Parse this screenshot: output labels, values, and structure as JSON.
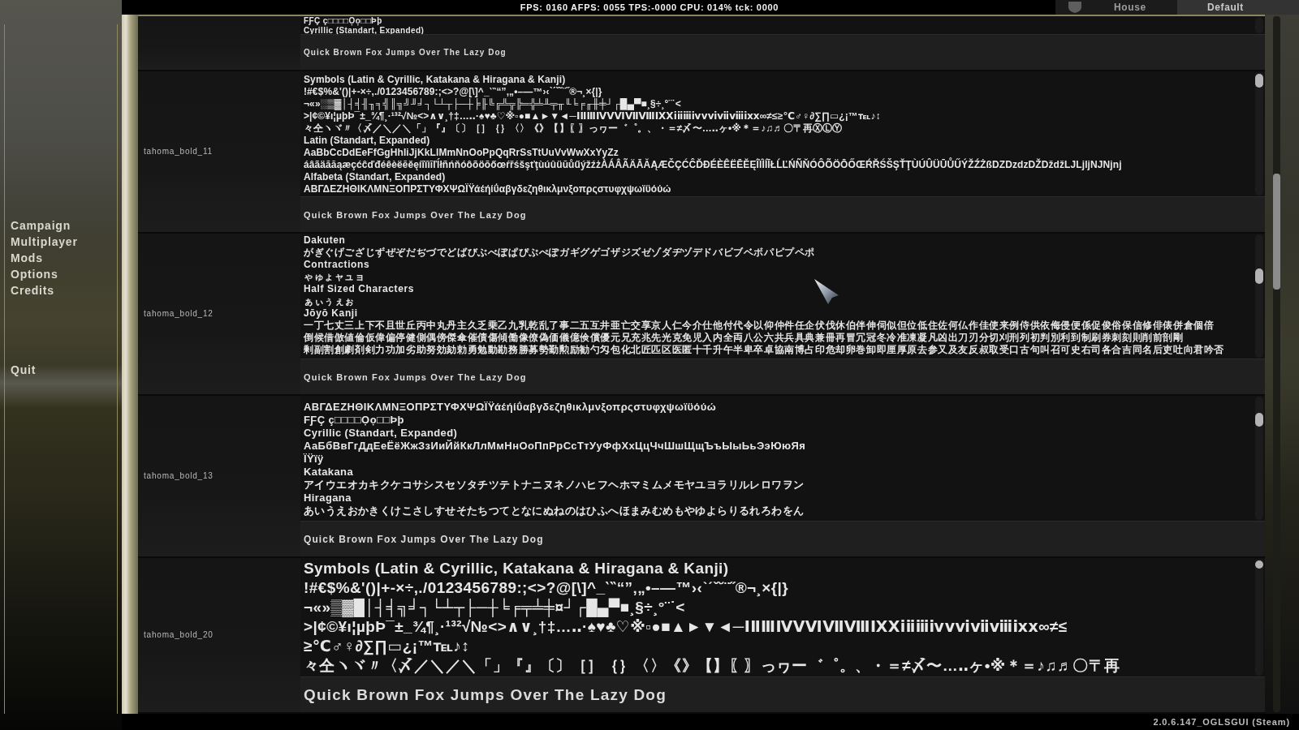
{
  "status_bar": {
    "text": "FPS: 0160 AFPS: 0055 TPS:-0000 CPU: 014% tck: 0000"
  },
  "header_items": [
    {
      "kind": "icon_label",
      "label": "House"
    },
    {
      "kind": "label",
      "label": "Default"
    }
  ],
  "menu": {
    "items": [
      {
        "label": "Campaign"
      },
      {
        "label": "Multiplayer"
      },
      {
        "label": "Mods"
      },
      {
        "label": "Options"
      },
      {
        "label": "Credits"
      }
    ],
    "bottom_items": [
      {
        "label": "Quit"
      }
    ]
  },
  "font_rows": [
    {
      "lines": [
        "FƑÇ ç□□□□Ọọ□□Þþ",
        "Cyrillic (Standart, Expanded)"
      ],
      "preview": "Quick Brown Fox Jumps Over The Lazy Dog"
    },
    {
      "label": "tahoma_bold_11",
      "lines": [
        "Symbols (Latin & Cyrillic, Katakana & Hiragana & Kanji)",
        "!#€$%&'()|+-×÷,./0123456789:;<>?@[\\]^_‵‶“”‚„•–—™›‹ˋˊˇ˘¨˝®¬¸×{|}",
        "¬«»░▒▓│┤╡╢╖╕╣║╗╝╜╛┐└┴┬├─┼╞╟╚╔╩╦╠═╬╧╨╤╥╙╘╒╓╫╪┘┌█▄▀■¸§÷¸°¨˙<",
        ">|¢©¥ı¦µþÞ¯±_¾¶¸·¹³²√№<>∧∨¸†‡…‥·♠♥♣♡※▫●■▲►▼◄─ⅠⅡⅢⅣⅤⅥⅦⅧⅨⅩⅰⅱⅲⅳⅴⅵⅶⅷⅸⅹ∞≠≤≥℃♂♀∂∑∏▭¿¡™℡♪↕",
        "々仝ヽヾ〃〈〆／＼／＼「」『』〔〕［］｛｝〈〉《》【】〖〗っヮー゛゜。、・＝≠〆〜…‥ヶ•※＊＝♪♫♬〇〒再ⓍⓁⓎ",
        "Latin (Standart, Expanded)",
        "AaBbCcDdEeFfGgHhIiJjKkLlMmNnOoPpQqRrSsTtUuVvWwXxYyZz",
        "áâãäāăąæçćĉďđéêèëēěęíîïìīľĺłñńňóôõöōőœŕřśšşťţùúûüūůűýžźżÀÁÂÃÄĀĂĄÆČÇĆĈĎĐÉÈÊËĒĚĘÎÏÌÍĪŁĹĽŃÑŇÓÔÕÖŌŐŒŔŘŚŠŞŤŢÙÚÛÜŪŮŰÝŽŹŻßDZDzdzDŽDždžLJLjljNJNjnj",
        "Alfabeta (Standart, Expanded)",
        "ΑΒΓΔΕΖΗΘΙΚΛΜΝΞΟΠΡΣΤΥΦΧΨΩΪΫάέήίΰαβγδεζηθικλμνξοπρςστυφχψωϊϋόύώ"
      ],
      "preview": "Quick Brown Fox Jumps Over The Lazy Dog"
    },
    {
      "label": "tahoma_bold_12",
      "lines": [
        "Dakuten",
        "がぎぐげござじずぜぞだぢづでどばびぶべぼぱぴぷぺぽガギグゲゴザジズゼゾダヂヅデドバビブベボパピプペポ",
        "Contractions",
        "ゃゅょャュョ",
        "Half Sized Characters",
        "ぁぃぅぇぉ",
        "Jōyō Kanji",
        "一丁七丈三上下不且世丘丙中丸丹主久乏乗乙九乳乾乱了事二五互井亜亡交享京人仁今介仕他付代令以仰仲件任企伏伐休伯伴伸伺似但位低住佐何仏作佳使来例侍供依侮侵便係促俊俗保信修俳俵併倉個倍",
        "倒候借倣値倫仮偉偏停健側偶傍傑傘催債傷傾働像僚偽価儀億倹償優元兄充兆先光克免児入内全両八公六共兵具典兼冊再冒冗冠冬冷准凍凝凡凶出刀刃分切刈刑列初判別利到制刷券刺刻則削前剖剛",
        "剰副割創劇剤剣力功加劣助努効劾勅勇勉動勘務勝募勢勤勲励勧勺匁包化北匠匹区医匿十千升午半卑卒卓協南博占印危却卵巻卸即厘厚原去参又及友反叔取受口古句叫召可史右司各合吉同名后吏吐向君吟否"
      ],
      "preview": "Quick Brown Fox Jumps Over The Lazy Dog"
    },
    {
      "label": "tahoma_bold_13",
      "lines": [
        "ΑΒΓΔΕΖΗΘΙΚΛΜΝΞΟΠΡΣΤΥΦΧΨΩΪΫάέήίΰαβγδεζηθικλμνξοπρςστυφχψωϊϋόύώ",
        "FƑÇ ç□□□□Ọọ□□Þþ",
        "Cyrillic (Standart, Expanded)",
        "АаБбВвГгДдЕеЁёЖжЗзИиЙйКкЛлМмНнОоПпРрСсТтУуФфХхЦцЧчШшЩщЪъЫыЬьЭэЮюЯя",
        "ÏŸïÿ",
        "Katakana",
        "アイウエオカキクケコサシスセソタチツテトナニヌネノハヒフヘホマミムメモヤユヨラリルレロワヲン",
        "Hiragana",
        "あいうえおかきくけこさしすせそたちつてとなにぬねのはひふへほまみむめもやゆよらりるれろわをん"
      ],
      "preview": "Quick Brown Fox Jumps Over The Lazy Dog"
    },
    {
      "label": "tahoma_bold_20",
      "lines": [
        "Symbols (Latin & Cyrillic, Katakana & Hiragana & Kanji)",
        "!#€$%&'()|+-×÷,./0123456789:;<>?@[\\]^_‵‶“”‚„•–—™›‹ˋˊˇ˘¨˝®¬¸×{|}",
        "¬«»▒▓█│┤╡╗╛┐└┴┬├─┼╘╒╤╧╪¤┘┌█▄▀■¸§÷¸°¨˙<",
        ">|¢©¥ı¦µþÞ¯±_¾¶¸·¹³²√№<>∧∨¸†‡…‥·♠♥♣♡※▫●■▲►▼◄─ⅠⅡⅢⅣⅤⅥⅦⅧⅨⅩⅰⅱⅲⅳⅴⅵⅶⅷⅸⅹ∞≠≤",
        "≥℃♂♀∂∑∏▭¿¡™℡♪↕",
        "々仝ヽヾ〃〈〆／＼／＼「」『』〔〕［］｛｝〈〉《》【】〖〗っヮー゛゜。、・＝≠〆〜…‥ヶ•※＊＝♪♫♬〇〒再"
      ],
      "preview": "Quick Brown Fox Jumps Over The Lazy Dog"
    }
  ],
  "version": "2.0.6.147_OGLSGUI (Steam)"
}
